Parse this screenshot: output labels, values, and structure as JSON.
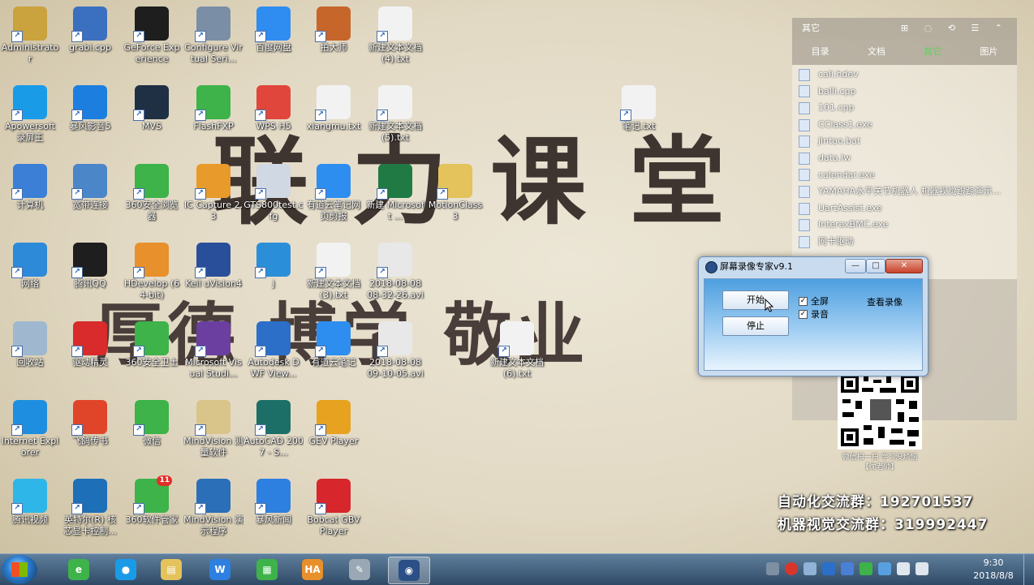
{
  "wallpaper": {
    "line1": "联 力 课 堂",
    "line2": "厚德 博学 敬业"
  },
  "desktop_icons": [
    {
      "label": "Administrato r",
      "icon": "user-folder-icon",
      "color": "#caa23e"
    },
    {
      "label": "grabi.cpp",
      "icon": "cpp-file-icon",
      "color": "#3b6fbf"
    },
    {
      "label": "GeForce Experience",
      "icon": "nvidia-icon",
      "color": "#1e1e1e"
    },
    {
      "label": "Configure Virtual Seri...",
      "icon": "serial-port-icon",
      "color": "#7a8fa6"
    },
    {
      "label": "百度网盘",
      "icon": "baidu-netdisk-icon",
      "color": "#2f8cf0"
    },
    {
      "label": "拍大师",
      "icon": "paidashi-icon",
      "color": "#c7662a"
    },
    {
      "label": "新建文本文档 (4).txt",
      "icon": "text-file-icon",
      "color": "#f2f2f2"
    },
    {
      "label": "Apowersoft 录屏王",
      "icon": "apowersoft-icon",
      "color": "#1a9be8"
    },
    {
      "label": "暴风影音5",
      "icon": "baofeng-icon",
      "color": "#1c7fe0"
    },
    {
      "label": "MVS",
      "icon": "mvs-icon",
      "color": "#1f2f44"
    },
    {
      "label": "FlashFXP",
      "icon": "flashfxp-icon",
      "color": "#3db34a"
    },
    {
      "label": "WPS H5",
      "icon": "wps-h5-icon",
      "color": "#e0463c"
    },
    {
      "label": "xiangmu.txt",
      "icon": "text-file-icon",
      "color": "#f2f2f2"
    },
    {
      "label": "新建文本文档 (5).txt",
      "icon": "text-file-icon",
      "color": "#f2f2f2"
    },
    {
      "label": "笔记.txt",
      "icon": "text-file-icon",
      "color": "#f2f2f2"
    },
    {
      "label": "计算机",
      "icon": "computer-icon",
      "color": "#3b7fd6"
    },
    {
      "label": "宽带连接",
      "icon": "network-connection-icon",
      "color": "#4a86c8"
    },
    {
      "label": "360安全浏览器",
      "icon": "360-browser-icon",
      "color": "#3db34a"
    },
    {
      "label": "IC Capture 2.3",
      "icon": "ic-capture-icon",
      "color": "#e89a2a"
    },
    {
      "label": "GTS800test.cfg",
      "icon": "cfg-file-icon",
      "color": "#cfd8e3"
    },
    {
      "label": "有道云笔记网页剪报",
      "icon": "youdao-clip-icon",
      "color": "#2d8ef0"
    },
    {
      "label": "新建 Microsoft ...",
      "icon": "excel-file-icon",
      "color": "#1f7a43"
    },
    {
      "label": "MotionClass 3",
      "icon": "folder-icon",
      "color": "#e4c35c"
    },
    {
      "label": "网络",
      "icon": "network-icon",
      "color": "#2c8ad8"
    },
    {
      "label": "腾讯QQ",
      "icon": "qq-icon",
      "color": "#1e1e1e"
    },
    {
      "label": "HDevelop (64-bit)",
      "icon": "hdevelop-icon",
      "color": "#e8902c"
    },
    {
      "label": "Keil uVision4",
      "icon": "keil-icon",
      "color": "#2a4f9a"
    },
    {
      "label": "j",
      "icon": "app-j-icon",
      "color": "#2a8fd8"
    },
    {
      "label": "新建文本文档 (3).txt",
      "icon": "text-file-icon",
      "color": "#f2f2f2"
    },
    {
      "label": "2018-08-08 08-32-26.avi",
      "icon": "video-file-icon",
      "color": "#e8e8e8"
    },
    {
      "label": "回收站",
      "icon": "recycle-bin-icon",
      "color": "#9fb8cf"
    },
    {
      "label": "驱动精灵",
      "icon": "qudong-icon",
      "color": "#d92b2b"
    },
    {
      "label": "360安全卫士",
      "icon": "360-safe-icon",
      "color": "#3db34a"
    },
    {
      "label": "Microsoft Visual Studi...",
      "icon": "visual-studio-icon",
      "color": "#6b3fa0"
    },
    {
      "label": "Autodesk DWF View...",
      "icon": "dwf-viewer-icon",
      "color": "#2b6fc9"
    },
    {
      "label": "有道云笔记",
      "icon": "youdao-note-icon",
      "color": "#2d8ef0"
    },
    {
      "label": "2018-08-08 09-10-05.avi",
      "icon": "video-file-icon",
      "color": "#e8e8e8"
    },
    {
      "label": "新建文本文档 (6).txt",
      "icon": "text-file-icon",
      "color": "#f2f2f2"
    },
    {
      "label": "Internet Explorer",
      "icon": "ie-icon",
      "color": "#1e8fe0"
    },
    {
      "label": "飞鸽传书",
      "icon": "feige-icon",
      "color": "#e0452a"
    },
    {
      "label": "微信",
      "icon": "wechat-icon",
      "color": "#3db34a"
    },
    {
      "label": "MindVision 测量软件",
      "icon": "mindvision-measure-icon",
      "color": "#d9c48a"
    },
    {
      "label": "AutoCAD 2007 - S...",
      "icon": "autocad-icon",
      "color": "#1c6f66"
    },
    {
      "label": "GEV Player",
      "icon": "gev-player-icon",
      "color": "#e7a21f"
    },
    {
      "label": "腾讯视频",
      "icon": "tencent-video-icon",
      "color": "#2fb6e8"
    },
    {
      "label": "英特尔(R) 核芯显卡控制...",
      "icon": "intel-graphics-icon",
      "color": "#1d6fb8"
    },
    {
      "label": "360软件管家",
      "icon": "360-software-icon",
      "color": "#3db34a",
      "badge": "11"
    },
    {
      "label": "MindVision 演示程序",
      "icon": "mindvision-demo-icon",
      "color": "#2a6fb8"
    },
    {
      "label": "暴风新闻",
      "icon": "baofeng-news-icon",
      "color": "#2d7fe0"
    },
    {
      "label": "Bobcat GBV Player",
      "icon": "bobcat-icon",
      "color": "#d7262c"
    }
  ],
  "side_panel": {
    "title": "其它",
    "tabs": [
      "目录",
      "文档",
      "其它",
      "图片"
    ],
    "active_tab": "其它",
    "files": [
      "cali.hdev",
      "balli.cpp",
      "101.cpp",
      "CClass1.exe",
      "jintao.bat",
      "data.lw",
      "calendar.exe",
      "YAMAHA水平关节机器人 机器视觉跟踪演示...",
      "UartAssist.exe",
      "InterexBMC.exe",
      "网卡驱动"
    ]
  },
  "recorder_dialog": {
    "title": "屏幕录像专家v9.1",
    "start_label": "开始",
    "stop_label": "停止",
    "fullscreen_label": "全屏",
    "audio_label": "录音",
    "fullscreen_checked": true,
    "audio_checked": true,
    "view_label": "查看录像",
    "min_glyph": "—",
    "max_glyph": "□",
    "close_glyph": "✕",
    "check_glyph": "✓"
  },
  "qr": {
    "caption1": "微信扫一扫 学习没烦恼",
    "caption2": "【沈老师】"
  },
  "groups": {
    "line1": "自动化交流群：192701537",
    "line2": "机器视觉交流群：319992447"
  },
  "taskbar": {
    "apps": [
      {
        "name": "360-browser-tb-icon",
        "color": "#3db34a",
        "glyph": "e"
      },
      {
        "name": "apowersoft-tb-icon",
        "color": "#1a9be8",
        "glyph": "●"
      },
      {
        "name": "explorer-tb-icon",
        "color": "#e4c35c",
        "glyph": "▤"
      },
      {
        "name": "wps-tb-icon",
        "color": "#2d7fe0",
        "glyph": "W"
      },
      {
        "name": "wps-sheet-tb-icon",
        "color": "#3db34a",
        "glyph": "▦"
      },
      {
        "name": "hdevelop-tb-icon",
        "color": "#e8902c",
        "glyph": "HA"
      },
      {
        "name": "paint-tb-icon",
        "color": "#9aa7b4",
        "glyph": "✎"
      },
      {
        "name": "recorder-tb-icon",
        "color": "#2b4f86",
        "glyph": "◉"
      }
    ],
    "time": "9:30",
    "date": "2018/8/8"
  }
}
